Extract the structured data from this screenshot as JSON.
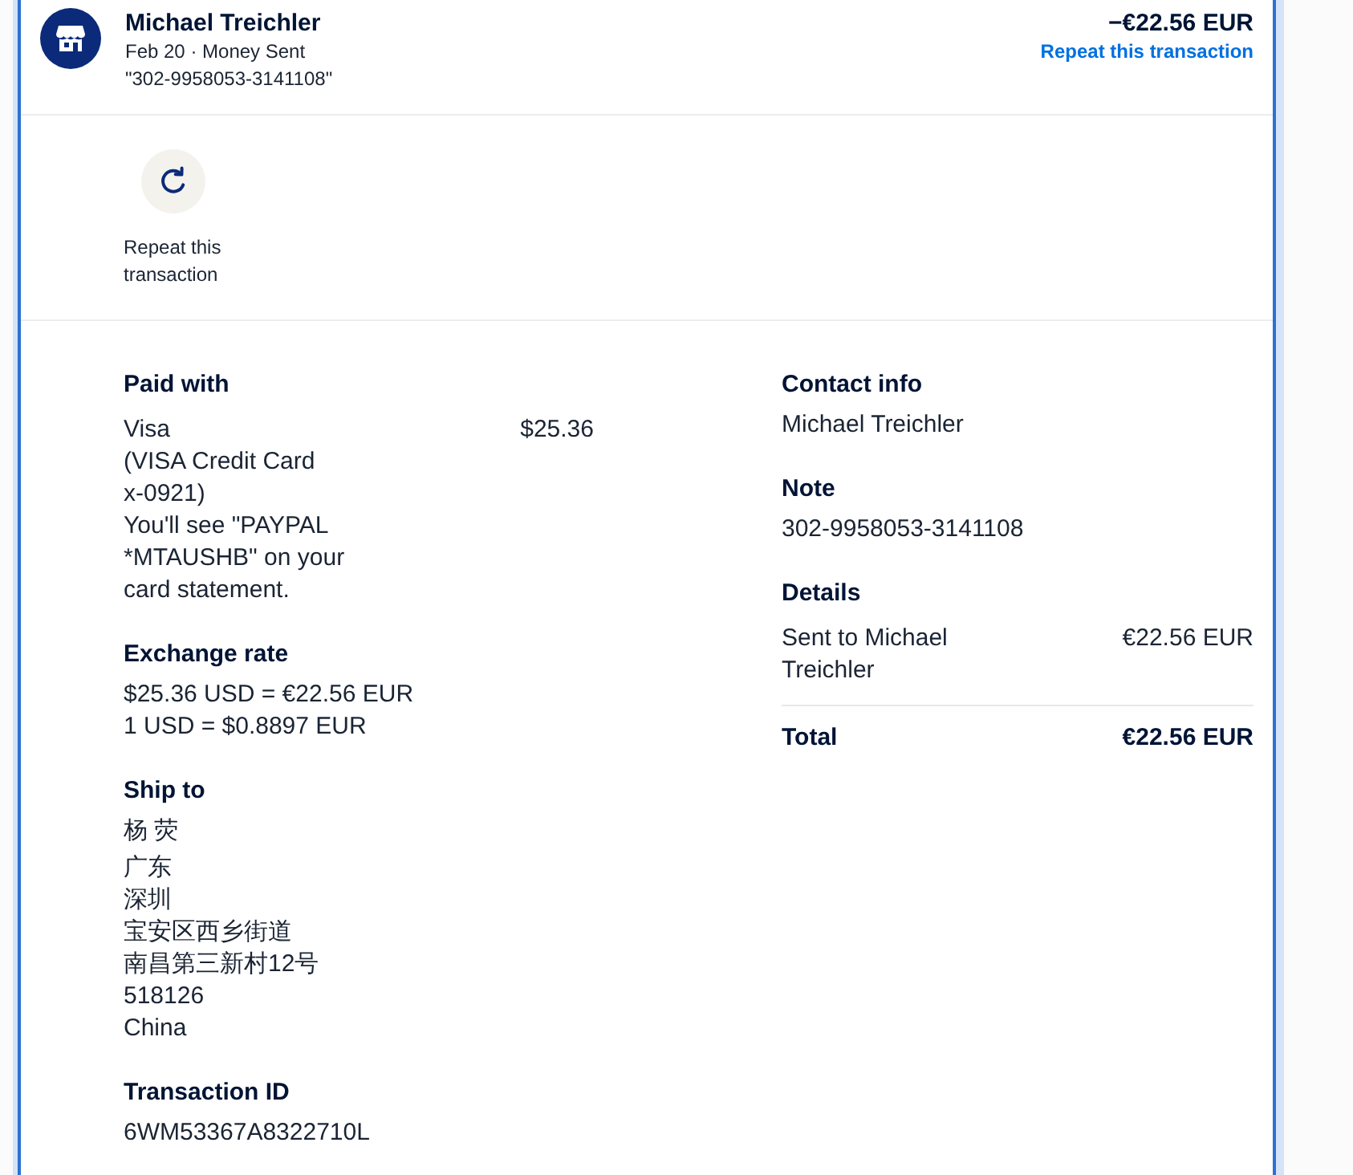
{
  "header": {
    "name": "Michael Treichler",
    "subtitle": "Feb 20 · Money Sent",
    "reference": "\"302-9958053-3141108\"",
    "amount": "−€22.56 EUR",
    "link": "Repeat this transaction"
  },
  "actions": [
    {
      "label": "Repeat this transaction"
    }
  ],
  "left_column": [
    {
      "kind": "payment",
      "heading": "Paid with",
      "lines": [
        "Visa",
        "(VISA Credit Card x-0921)",
        "You'll see \"PAYPAL *MTAUSHB\" on your card statement."
      ],
      "amount": "$25.36"
    },
    {
      "kind": "text",
      "heading": "Exchange rate",
      "lines": [
        "$25.36 USD = €22.56 EUR",
        "1 USD = $0.8897 EUR"
      ]
    },
    {
      "kind": "address",
      "heading": "Ship to",
      "name": "杨 荧",
      "lines": [
        "广东",
        "深圳",
        "宝安区西乡街道",
        "南昌第三新村12号",
        "518126",
        "China"
      ]
    },
    {
      "kind": "text",
      "heading": "Transaction ID",
      "lines": [
        "6WM53367A8322710L"
      ]
    }
  ],
  "right_column": [
    {
      "kind": "text",
      "heading": "Contact info",
      "lines": [
        "Michael Treichler"
      ]
    },
    {
      "kind": "text",
      "heading": "Note",
      "lines": [
        "302-9958053-3141108"
      ]
    },
    {
      "kind": "details",
      "heading": "Details",
      "items": [
        {
          "label": "Sent to Michael Treichler",
          "amount": "€22.56 EUR"
        }
      ],
      "total_label": "Total",
      "total_amount": "€22.56 EUR"
    }
  ]
}
